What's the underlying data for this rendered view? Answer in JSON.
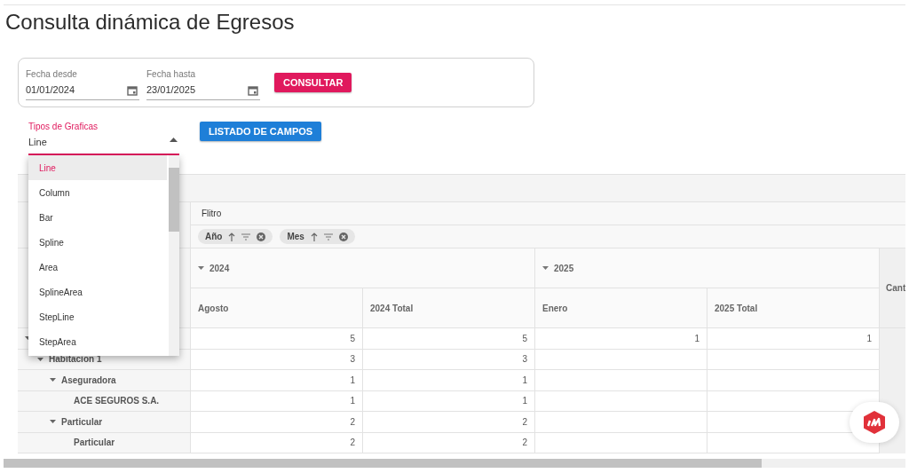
{
  "page_title": "Consulta dinámica de Egresos",
  "date_filters": [
    {
      "label": "Fecha desde",
      "value": "01/01/2024"
    },
    {
      "label": "Fecha hasta",
      "value": "23/01/2025"
    }
  ],
  "query_button": "CONSULTAR",
  "chart_type_select": {
    "label": "Tipos de Graficas",
    "value": "Line",
    "expanded": true,
    "options": [
      {
        "label": "Line",
        "selected": true
      },
      {
        "label": "Column",
        "selected": false
      },
      {
        "label": "Bar",
        "selected": false
      },
      {
        "label": "Spline",
        "selected": false
      },
      {
        "label": "Area",
        "selected": false
      },
      {
        "label": "SplineArea",
        "selected": false
      },
      {
        "label": "StepLine",
        "selected": false
      },
      {
        "label": "StepArea",
        "selected": false
      }
    ]
  },
  "fields_button": "LISTADO DE CAMPOS",
  "pivot": {
    "filter_label": "Flitro",
    "row_chips": [
      "Año",
      "Mes"
    ],
    "column_groups": [
      {
        "label": "2024",
        "expanded": true,
        "columns": [
          "Agosto",
          "2024 Total"
        ]
      },
      {
        "label": "2025",
        "expanded": true,
        "columns": [
          "Enero",
          "2025 Total"
        ]
      }
    ],
    "extra_column": "Cant",
    "rows": [
      {
        "expanded": true,
        "values": [
          "5",
          "5",
          "1",
          "1"
        ],
        "children": [
          {
            "label": "Habitacion 1",
            "expanded": true,
            "values": [
              "3",
              "3"
            ],
            "children": [
              {
                "label": "Aseguradora",
                "expanded": true,
                "values": [
                  "1",
                  "1"
                ],
                "children": [
                  {
                    "label": "ACE SEGUROS S.A.",
                    "values": [
                      "1",
                      "1"
                    ]
                  }
                ]
              },
              {
                "label": "Particular",
                "expanded": true,
                "values": [
                  "2",
                  "2"
                ],
                "children": [
                  {
                    "label": "Particular",
                    "values": [
                      "2",
                      "2"
                    ]
                  }
                ]
              }
            ]
          }
        ]
      }
    ]
  }
}
